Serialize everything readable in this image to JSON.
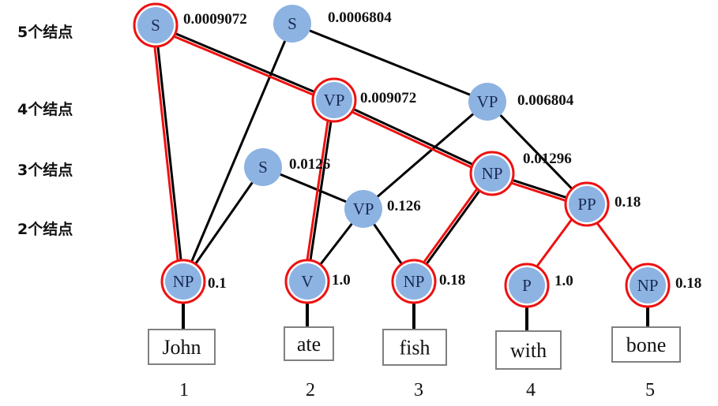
{
  "row_labels": [
    "5个结点",
    "4个结点",
    "3个结点",
    "2个结点"
  ],
  "colors": {
    "node_fill": "#8db3e2",
    "highlight": "#ee1111",
    "edge": "#000000",
    "box_border": "#808080"
  },
  "nodes": [
    {
      "id": "S1",
      "label": "S",
      "prob": "0.0009072",
      "highlight": true
    },
    {
      "id": "S2",
      "label": "S",
      "prob": "0.0006804",
      "highlight": false
    },
    {
      "id": "VP1",
      "label": "VP",
      "prob": "0.009072",
      "highlight": true
    },
    {
      "id": "VP2",
      "label": "VP",
      "prob": "0.006804",
      "highlight": false
    },
    {
      "id": "S3",
      "label": "S",
      "prob": "0.0126",
      "highlight": false
    },
    {
      "id": "NP3",
      "label": "NP",
      "prob": "0.01296",
      "highlight": true
    },
    {
      "id": "VP3",
      "label": "VP",
      "prob": "0.126",
      "highlight": false
    },
    {
      "id": "PP",
      "label": "PP",
      "prob": "0.18",
      "highlight": true
    },
    {
      "id": "NP1",
      "label": "NP",
      "prob": "0.1",
      "highlight": true
    },
    {
      "id": "V",
      "label": "V",
      "prob": "1.0",
      "highlight": true
    },
    {
      "id": "NP2",
      "label": "NP",
      "prob": "0.18",
      "highlight": true
    },
    {
      "id": "P",
      "label": "P",
      "prob": "1.0",
      "highlight": true
    },
    {
      "id": "NP5",
      "label": "NP",
      "prob": "0.18",
      "highlight": true
    }
  ],
  "words": [
    {
      "text": "John",
      "index": "1"
    },
    {
      "text": "ate",
      "index": "2"
    },
    {
      "text": "fish",
      "index": "3"
    },
    {
      "text": "with",
      "index": "4"
    },
    {
      "text": "bone",
      "index": "5"
    }
  ],
  "edges": [
    [
      "S1",
      "NP1"
    ],
    [
      "S1",
      "VP1"
    ],
    [
      "S2",
      "NP1"
    ],
    [
      "S2",
      "VP2"
    ],
    [
      "VP1",
      "V"
    ],
    [
      "VP1",
      "NP3"
    ],
    [
      "VP2",
      "VP3"
    ],
    [
      "VP2",
      "PP"
    ],
    [
      "S3",
      "NP1"
    ],
    [
      "S3",
      "VP3"
    ],
    [
      "VP3",
      "V"
    ],
    [
      "VP3",
      "NP2"
    ],
    [
      "NP3",
      "NP2"
    ],
    [
      "NP3",
      "PP"
    ]
  ],
  "best_path_edges": [
    [
      "S1",
      "NP1"
    ],
    [
      "S1",
      "VP1"
    ],
    [
      "VP1",
      "V"
    ],
    [
      "VP1",
      "NP3"
    ],
    [
      "NP3",
      "NP2"
    ],
    [
      "NP3",
      "PP"
    ],
    [
      "PP",
      "P"
    ],
    [
      "PP",
      "NP5"
    ]
  ]
}
